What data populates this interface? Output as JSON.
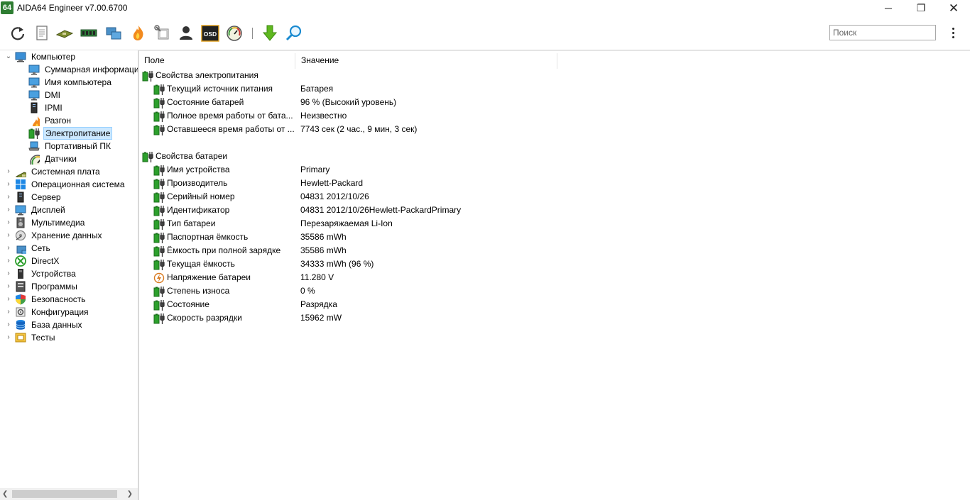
{
  "window": {
    "logo_text": "64",
    "title": "AIDA64 Engineer v7.00.6700",
    "minimize_glyph": "─",
    "maximize_glyph": "❐",
    "close_glyph": "✕"
  },
  "toolbar": {
    "buttons": [
      {
        "icon": "refresh-icon"
      },
      {
        "icon": "report-icon"
      },
      {
        "icon": "motherboard-icon"
      },
      {
        "icon": "memory-icon"
      },
      {
        "icon": "network-icon"
      },
      {
        "icon": "flame-icon"
      },
      {
        "icon": "tools-icon"
      },
      {
        "icon": "user-icon"
      },
      {
        "icon": "osd-icon",
        "label": "OSD"
      },
      {
        "icon": "gauge-icon"
      },
      {
        "icon": "download-arrow-icon"
      },
      {
        "icon": "magnifier-icon"
      }
    ],
    "search_placeholder": "Поиск"
  },
  "tree": {
    "root": {
      "label": "Компьютер",
      "icon": "computer-icon",
      "expanded": true
    },
    "children": [
      {
        "label": "Суммарная информация",
        "icon": "monitor-icon"
      },
      {
        "label": "Имя компьютера",
        "icon": "monitor-icon"
      },
      {
        "label": "DMI",
        "icon": "monitor-icon"
      },
      {
        "label": "IPMI",
        "icon": "server-icon"
      },
      {
        "label": "Разгон",
        "icon": "flame-icon"
      },
      {
        "label": "Электропитание",
        "icon": "battery-plug-icon",
        "selected": true
      },
      {
        "label": "Портативный ПК",
        "icon": "laptop-icon"
      },
      {
        "label": "Датчики",
        "icon": "gauge-icon"
      }
    ],
    "sections": [
      {
        "label": "Системная плата",
        "icon": "motherboard-icon"
      },
      {
        "label": "Операционная система",
        "icon": "windows-icon"
      },
      {
        "label": "Сервер",
        "icon": "server-icon"
      },
      {
        "label": "Дисплей",
        "icon": "monitor-icon"
      },
      {
        "label": "Мультимедиа",
        "icon": "speaker-icon"
      },
      {
        "label": "Хранение данных",
        "icon": "storage-icon"
      },
      {
        "label": "Сеть",
        "icon": "network-icon"
      },
      {
        "label": "DirectX",
        "icon": "xbox-icon"
      },
      {
        "label": "Устройства",
        "icon": "devices-icon"
      },
      {
        "label": "Программы",
        "icon": "programs-icon"
      },
      {
        "label": "Безопасность",
        "icon": "shield-icon"
      },
      {
        "label": "Конфигурация",
        "icon": "config-icon"
      },
      {
        "label": "База данных",
        "icon": "database-icon"
      },
      {
        "label": "Тесты",
        "icon": "benchmark-icon"
      }
    ]
  },
  "list": {
    "columns": {
      "field": "Поле",
      "value": "Значение"
    },
    "groups": [
      {
        "title": "Свойства электропитания",
        "rows": [
          {
            "field": "Текущий источник питания",
            "value": "Батарея",
            "icon": "battery-plug-icon"
          },
          {
            "field": "Состояние батарей",
            "value": "96 % (Высокий уровень)",
            "icon": "battery-plug-icon"
          },
          {
            "field": "Полное время работы от бата...",
            "value": "Неизвестно",
            "icon": "battery-plug-icon"
          },
          {
            "field": "Оставшееся время работы от ...",
            "value": "7743 сек (2 час., 9 мин, 3 сек)",
            "icon": "battery-plug-icon"
          }
        ]
      },
      {
        "title": "Свойства батареи",
        "rows": [
          {
            "field": "Имя устройства",
            "value": "Primary",
            "icon": "battery-plug-icon"
          },
          {
            "field": "Производитель",
            "value": "Hewlett-Packard",
            "icon": "battery-plug-icon"
          },
          {
            "field": "Серийный номер",
            "value": "04831 2012/10/26",
            "icon": "battery-plug-icon"
          },
          {
            "field": "Идентификатор",
            "value": "04831 2012/10/26Hewlett-PackardPrimary",
            "icon": "battery-plug-icon"
          },
          {
            "field": "Тип батареи",
            "value": "Перезаряжаемая Li-Ion",
            "icon": "battery-plug-icon"
          },
          {
            "field": "Паспортная ёмкость",
            "value": "35586 mWh",
            "icon": "battery-plug-icon"
          },
          {
            "field": "Ёмкость при полной зарядке",
            "value": "35586 mWh",
            "icon": "battery-plug-icon"
          },
          {
            "field": "Текущая ёмкость",
            "value": "34333 mWh  (96 %)",
            "icon": "battery-plug-icon"
          },
          {
            "field": "Напряжение батареи",
            "value": "11.280 V",
            "icon": "voltage-icon"
          },
          {
            "field": "Степень износа",
            "value": "0 %",
            "icon": "battery-plug-icon"
          },
          {
            "field": "Состояние",
            "value": "Разрядка",
            "icon": "battery-plug-icon"
          },
          {
            "field": "Скорость разрядки",
            "value": "15962 mW",
            "icon": "battery-plug-icon"
          }
        ]
      }
    ]
  },
  "colors": {
    "selection_bg": "#cce8ff",
    "selection_border": "#99d1ff",
    "battery_green": "#2ca02c",
    "logo_green": "#2e7d32"
  }
}
